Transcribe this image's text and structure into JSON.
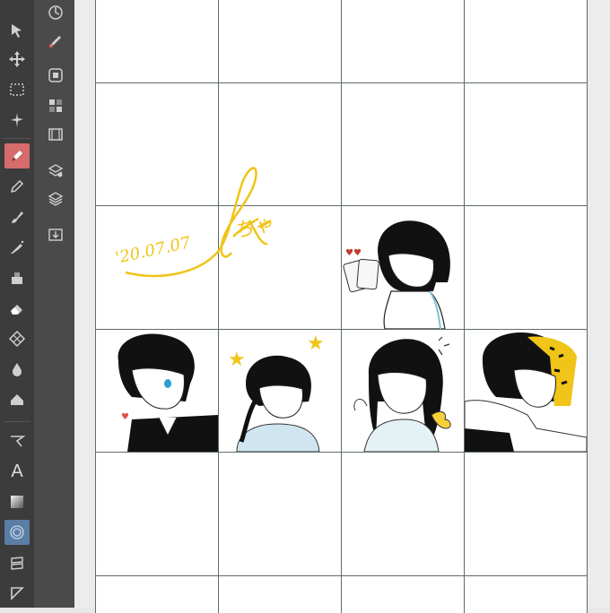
{
  "app": {
    "name": "Clip Studio Paint canvas"
  },
  "tools": [
    {
      "name": "operation-icon"
    },
    {
      "name": "move-icon"
    },
    {
      "name": "selection-icon"
    },
    {
      "name": "auto-select-icon"
    },
    {
      "name": "pen-icon"
    },
    {
      "name": "pencil-icon"
    },
    {
      "name": "brush-icon"
    },
    {
      "name": "airbrush-icon"
    },
    {
      "name": "decoration-icon"
    },
    {
      "name": "eraser-icon"
    },
    {
      "name": "blend-icon"
    },
    {
      "name": "fill-icon"
    },
    {
      "name": "figure-icon"
    },
    {
      "name": "text-icon"
    },
    {
      "name": "gradation-icon"
    },
    {
      "name": "balloon-icon"
    },
    {
      "name": "ruler-icon"
    },
    {
      "name": "frame-icon"
    }
  ],
  "text_tool_label": "A",
  "signature": {
    "date": "'20.07.07",
    "name": "ちゃ",
    "color": "#f0c419"
  },
  "colors": {
    "toolbar_bg": "#3c3c3c",
    "active_tool": "#d66b6b",
    "grid_line": "#5f6b66",
    "accent_yellow": "#f0c419"
  }
}
